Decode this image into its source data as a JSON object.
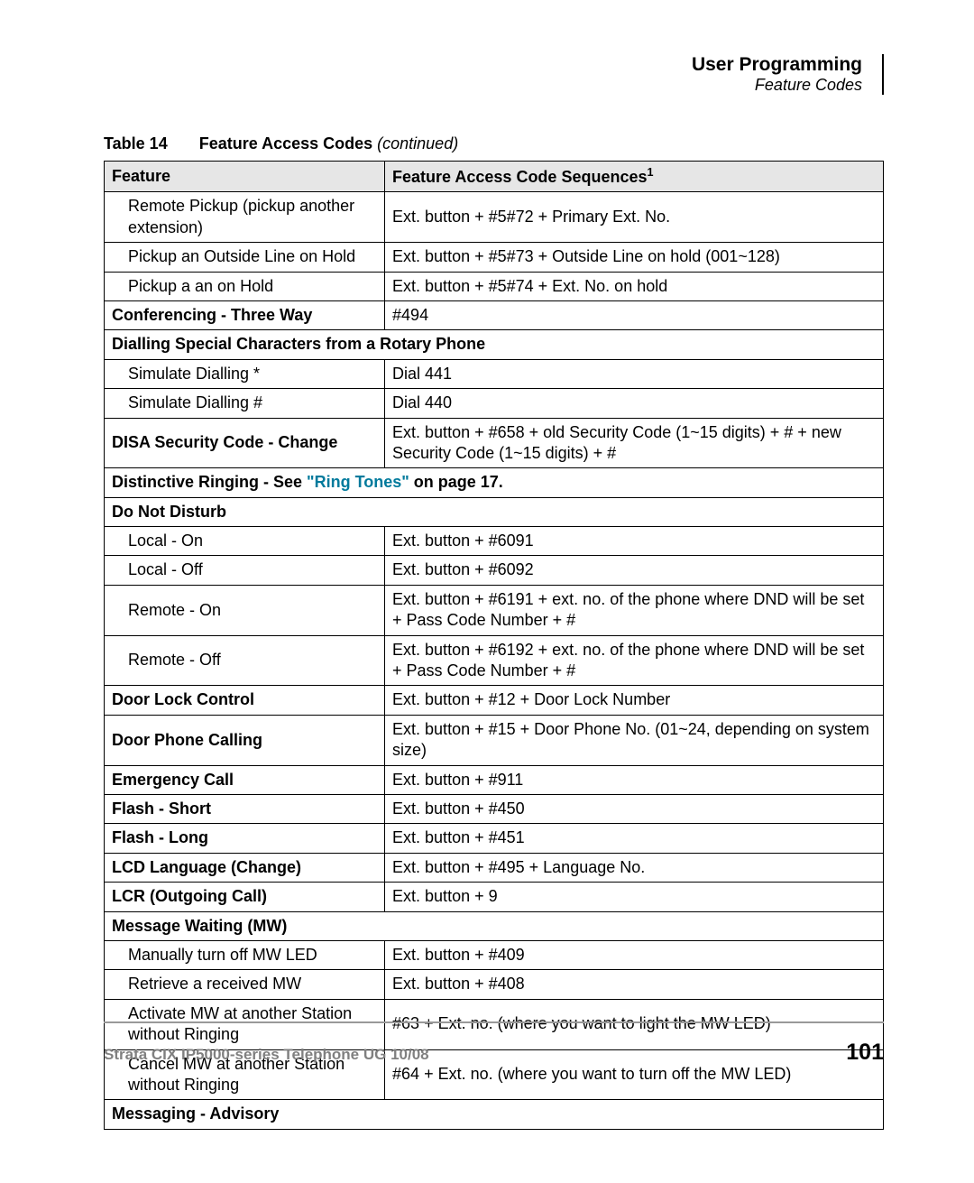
{
  "header": {
    "title": "User Programming",
    "subtitle": "Feature Codes"
  },
  "caption": {
    "tabno": "Table 14",
    "title": "Feature Access Codes ",
    "cont": "(continued)"
  },
  "th": {
    "feature": "Feature",
    "seq_pre": "Feature Access Code Sequences",
    "seq_sup": "1"
  },
  "rows": {
    "r1f": "Remote Pickup (pickup another extension)",
    "r1s": "Ext. button + #5#72 + Primary Ext. No.",
    "r2f": "Pickup an Outside Line on Hold",
    "r2s": "Ext. button + #5#73 + Outside Line on hold (001~128)",
    "r3f": "Pickup a an on Hold",
    "r3s": "Ext. button + #5#74 + Ext. No. on hold",
    "r4f": "Conferencing - Three Way",
    "r4s": "#494",
    "r5f": "Dialling Special Characters from a Rotary Phone",
    "r6f": "Simulate Dialling *",
    "r6s": "Dial 441",
    "r7f": "Simulate Dialling #",
    "r7s": "Dial 440",
    "r8f": "DISA Security Code - Change",
    "r8s": "Ext. button + #658 + old Security Code (1~15 digits) + # + new Security Code (1~15 digits) + #",
    "r9pre": "Distinctive Ringing - See ",
    "r9link": "\"Ring Tones\"",
    "r9post": " on page 17.",
    "r10f": "Do Not Disturb",
    "r11f": "Local - On",
    "r11s": "Ext. button + #6091",
    "r12f": "Local - Off",
    "r12s": "Ext. button + #6092",
    "r13f": "Remote - On",
    "r13s": "Ext. button + #6191 + ext. no. of the phone where DND will be set + Pass Code Number + #",
    "r14f": "Remote - Off",
    "r14s": "Ext. button + #6192 + ext. no. of the phone where DND will be set + Pass Code Number + #",
    "r15f": "Door Lock Control",
    "r15s": "Ext. button + #12 + Door Lock Number",
    "r16f": "Door Phone Calling",
    "r16s": "Ext. button + #15 + Door Phone No. (01~24, depending on system size)",
    "r17f": "Emergency Call",
    "r17s": "Ext. button + #911",
    "r18f": "Flash - Short",
    "r18s": "Ext. button + #450",
    "r19f": "Flash - Long",
    "r19s": "Ext. button + #451",
    "r20f": "LCD Language (Change)",
    "r20s": "Ext. button + #495 + Language No.",
    "r21f": "LCR (Outgoing Call)",
    "r21s": "Ext. button + 9",
    "r22f": "Message Waiting (MW)",
    "r23f": "Manually turn off MW LED",
    "r23s": "Ext. button + #409",
    "r24f": "Retrieve a received MW",
    "r24s": "Ext. button + #408",
    "r25f": "Activate MW at another Station without Ringing",
    "r25s": "#63 + Ext. no. (where you want to light the MW LED)",
    "r26f": "Cancel MW at another Station without Ringing",
    "r26s": "#64 + Ext. no. (where you want to turn off the MW LED)",
    "r27f": "Messaging - Advisory"
  },
  "footer": {
    "left": "Strata CIX IP5000-series Telephone UG    10/08",
    "right": "101"
  }
}
